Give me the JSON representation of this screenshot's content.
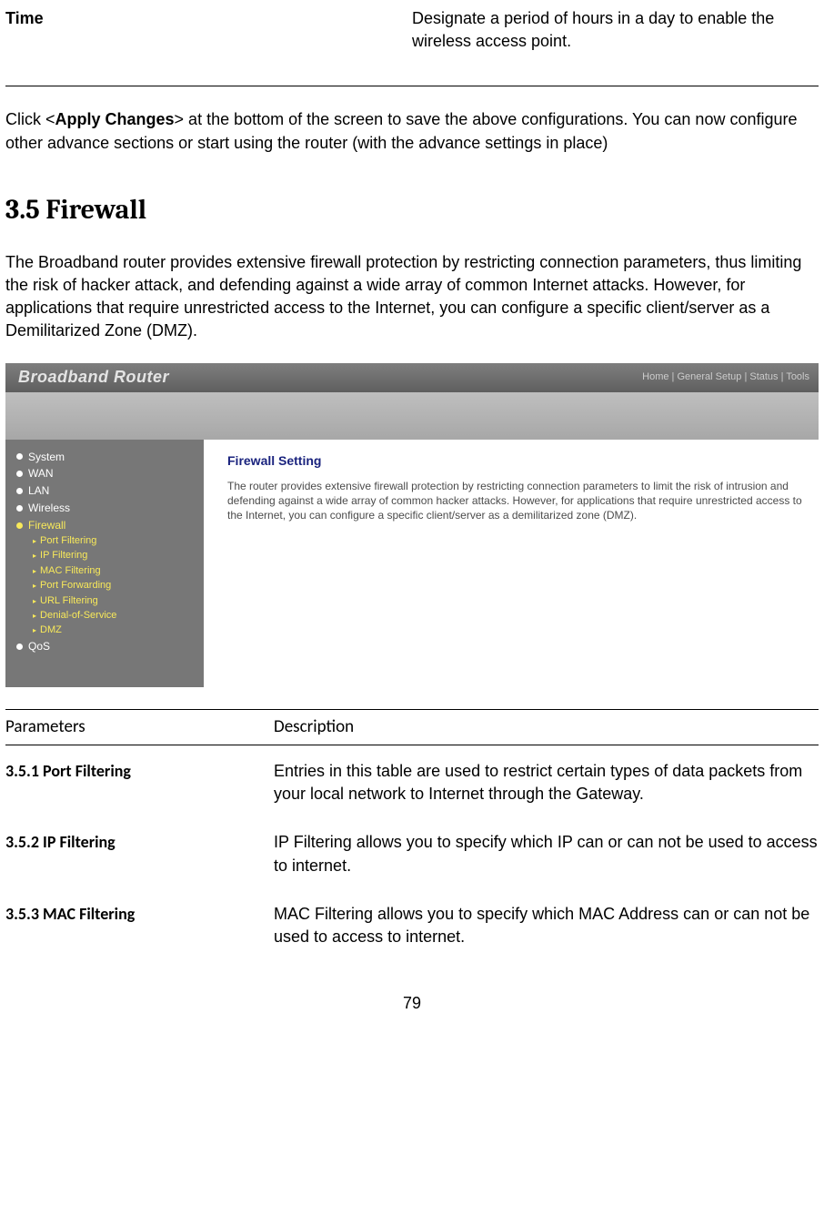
{
  "top_row": {
    "label": "Time",
    "desc": "Designate a period of hours in a day to enable the wireless access point."
  },
  "apply_text": {
    "p1a": "Click <",
    "p1b": "Apply Changes",
    "p1c": "> at the bottom of the screen to save the above configurations. You can now configure other advance sections or start using the router (with the advance settings in place)"
  },
  "section_heading": "3.5 Firewall",
  "intro": "The Broadband router provides extensive firewall protection by restricting connection parameters, thus limiting the risk of hacker attack, and defending against a wide array of common Internet attacks. However, for applications that require unrestricted access to the Internet, you can configure a specific client/server as a Demilitarized Zone (DMZ).",
  "router": {
    "brand": "Broadband Router",
    "top_links": "Home | General Setup | Status | Tools",
    "sidebar_top": [
      {
        "name": "system",
        "label": "System",
        "active": false
      },
      {
        "name": "wan",
        "label": "WAN",
        "active": false
      },
      {
        "name": "lan",
        "label": "LAN",
        "active": false
      },
      {
        "name": "wireless",
        "label": "Wireless",
        "active": false
      },
      {
        "name": "firewall",
        "label": "Firewall",
        "active": true
      }
    ],
    "sidebar_sub": [
      "Port Filtering",
      "IP Filtering",
      "MAC Filtering",
      "Port Forwarding",
      "URL Filtering",
      "Denial-of-Service",
      "DMZ"
    ],
    "sidebar_bottom": [
      {
        "name": "qos",
        "label": "QoS"
      }
    ],
    "panel_title": "Firewall Setting",
    "panel_text": "The router provides extensive firewall protection by restricting connection parameters to limit the risk of intrusion and defending against a wide array of common hacker attacks. However, for applications that require unrestricted access to the Internet, you can configure a specific client/server as a demilitarized zone (DMZ)."
  },
  "param_header": {
    "c1": "Parameters",
    "c2": "Description"
  },
  "params": [
    {
      "label": "3.5.1 Port Filtering",
      "desc": "Entries in this table are used to restrict certain types of data packets from your local network to Internet through the Gateway."
    },
    {
      "label": "3.5.2 IP Filtering",
      "desc": "IP Filtering allows you to specify which IP can or can not be used to access to internet."
    },
    {
      "label": "3.5.3 MAC Filtering",
      "desc": "MAC Filtering allows you to specify which MAC Address can or can not be used to access to internet."
    }
  ],
  "page_number": "79"
}
